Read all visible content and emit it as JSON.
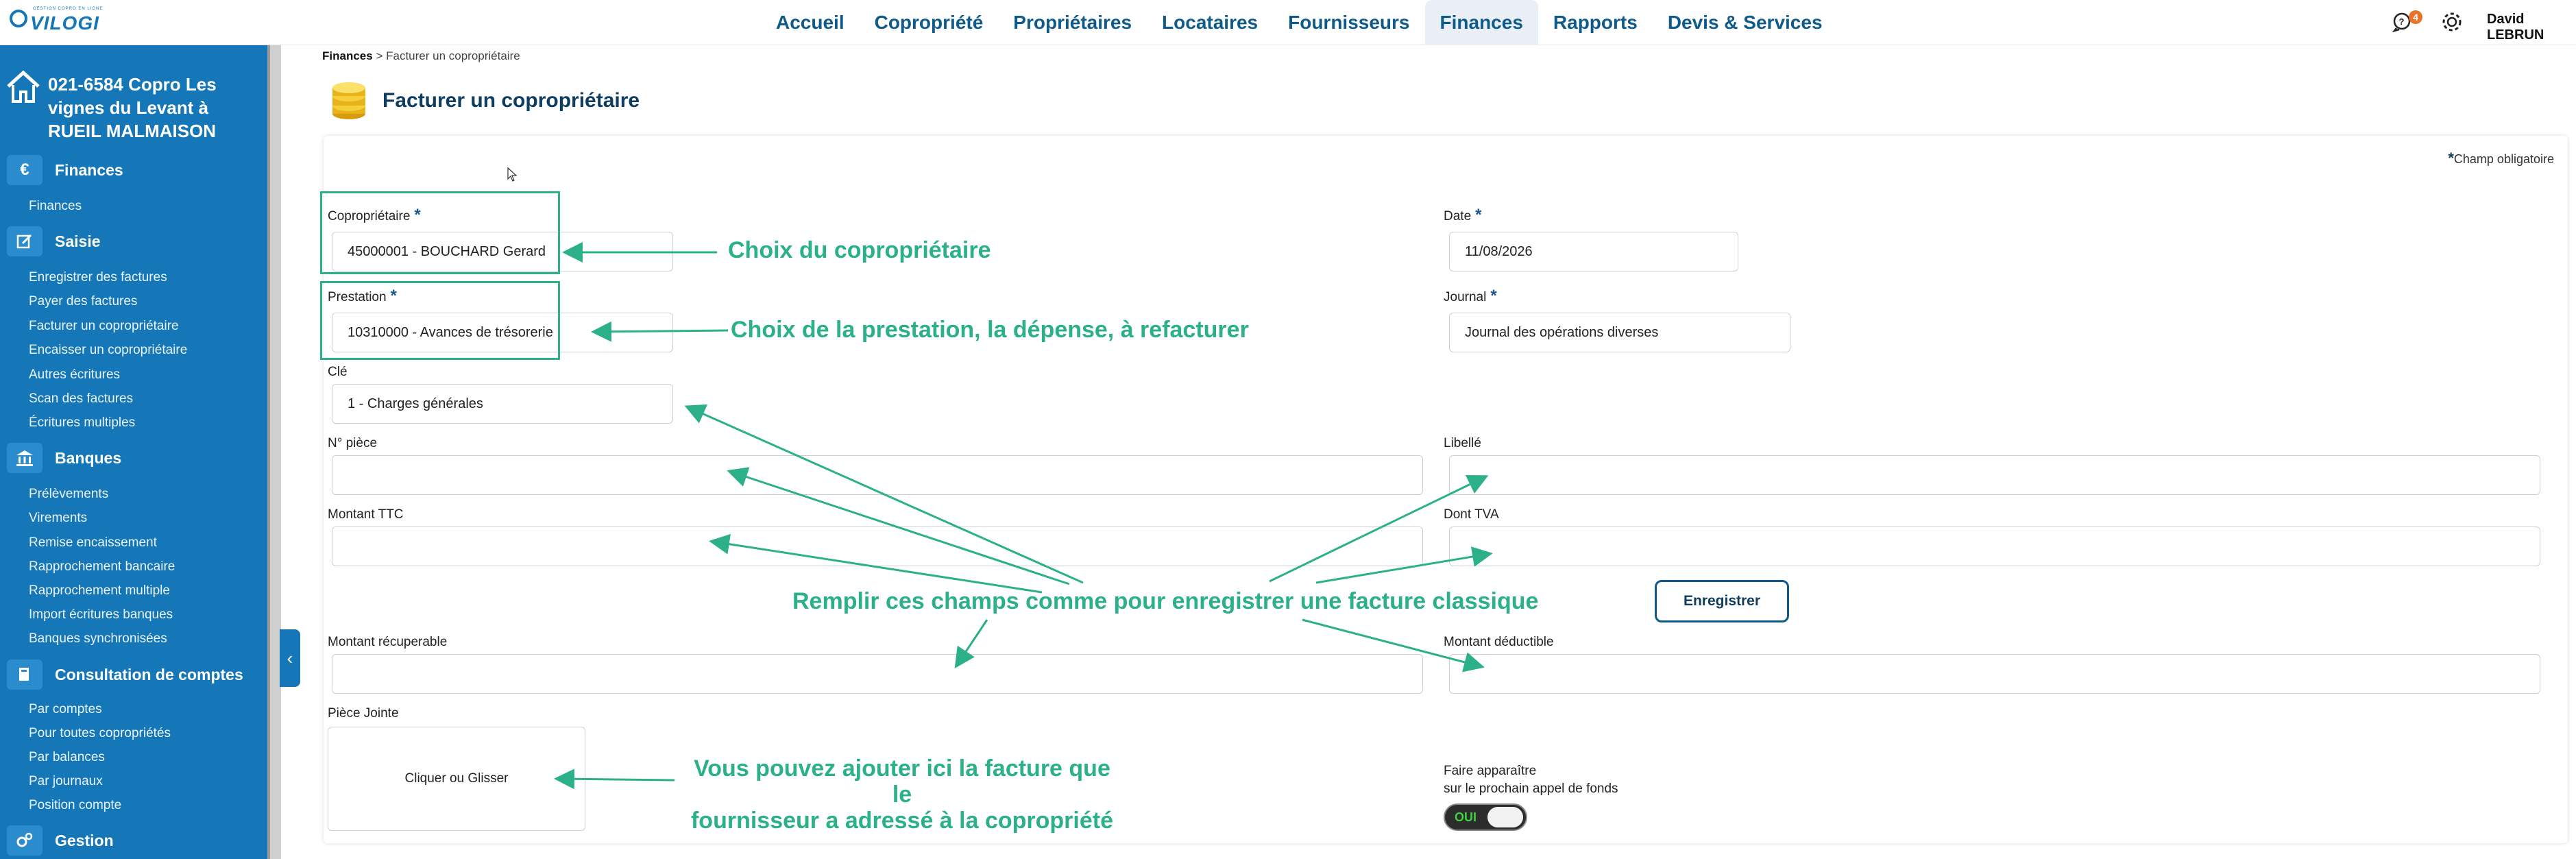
{
  "app": {
    "logo_text": "VILOGI",
    "logo_tagline": "GESTION COPRO EN LIGNE"
  },
  "nav": {
    "items": [
      {
        "label": "Accueil"
      },
      {
        "label": "Copropriété"
      },
      {
        "label": "Propriétaires"
      },
      {
        "label": "Locataires"
      },
      {
        "label": "Fournisseurs"
      },
      {
        "label": "Finances"
      },
      {
        "label": "Rapports"
      },
      {
        "label": "Devis & Services"
      }
    ],
    "active": "Finances"
  },
  "header": {
    "notification_count": "4",
    "user_name": "David LEBRUN"
  },
  "sidebar": {
    "copro_title": "021-6584 Copro Les vignes du Levant à RUEIL MALMAISON",
    "sections": [
      {
        "label": "Finances",
        "icon": "euro-icon",
        "links": [
          "Finances"
        ]
      },
      {
        "label": "Saisie",
        "icon": "edit-icon",
        "links": [
          "Enregistrer des factures",
          "Payer des factures",
          "Facturer un copropriétaire",
          "Encaisser un copropriétaire",
          "Autres écritures",
          "Scan des factures",
          "Écritures multiples"
        ]
      },
      {
        "label": "Banques",
        "icon": "bank-icon",
        "links": [
          "Prélèvements",
          "Virements",
          "Remise encaissement",
          "Rapprochement bancaire",
          "Rapprochement multiple",
          "Import écritures banques",
          "Banques synchronisées"
        ]
      },
      {
        "label": "Consultation de comptes",
        "icon": "book-icon",
        "links": [
          "Par comptes",
          "Pour toutes copropriétés",
          "Par balances",
          "Par journaux",
          "Position compte"
        ]
      },
      {
        "label": "Gestion",
        "icon": "gears-icon",
        "links": []
      }
    ]
  },
  "breadcrumb": {
    "root": "Finances",
    "separator": ">",
    "current": "Facturer un copropriétaire"
  },
  "page_title": "Facturer un copropriétaire",
  "form": {
    "required_note": "Champ obligatoire",
    "coproprietaire": {
      "label": "Copropriétaire",
      "value": "45000001 - BOUCHARD Gerard"
    },
    "date": {
      "label": "Date",
      "value": "11/08/2026"
    },
    "prestation": {
      "label": "Prestation",
      "value": "10310000 - Avances de trésorerie"
    },
    "journal": {
      "label": "Journal",
      "value": "Journal des opérations diverses"
    },
    "cle": {
      "label": "Clé",
      "value": "1 - Charges générales"
    },
    "num_piece": {
      "label": "N° pièce",
      "value": ""
    },
    "libelle": {
      "label": "Libellé",
      "value": ""
    },
    "montant_ttc": {
      "label": "Montant TTC",
      "value": ""
    },
    "dont_tva": {
      "label": "Dont TVA",
      "value": ""
    },
    "montant_recuperable": {
      "label": "Montant récuperable",
      "value": ""
    },
    "montant_deductible": {
      "label": "Montant déductible",
      "value": ""
    },
    "piece_jointe": {
      "label": "Pièce Jointe",
      "dropzone": "Cliquer ou Glisser"
    },
    "faire_apparaitre_line1": "Faire apparaître",
    "faire_apparaitre_line2": "sur le prochain appel de fonds",
    "toggle_label": "OUI",
    "save_label": "Enregistrer"
  },
  "annotations": {
    "choix_copro": "Choix du copropriétaire",
    "choix_prestation": "Choix de la prestation, la dépense, à refacturer",
    "remplir": "Remplir ces champs comme pour enregistrer une facture classique",
    "piece_line1": "Vous pouvez ajouter ici la facture que le",
    "piece_line2": "fournisseur a adressé à la copropriété"
  },
  "colors": {
    "sidebar": "#1577b8",
    "accent": "#0e5a8a",
    "annotation": "#2bb08a",
    "badge": "#e8732b"
  }
}
